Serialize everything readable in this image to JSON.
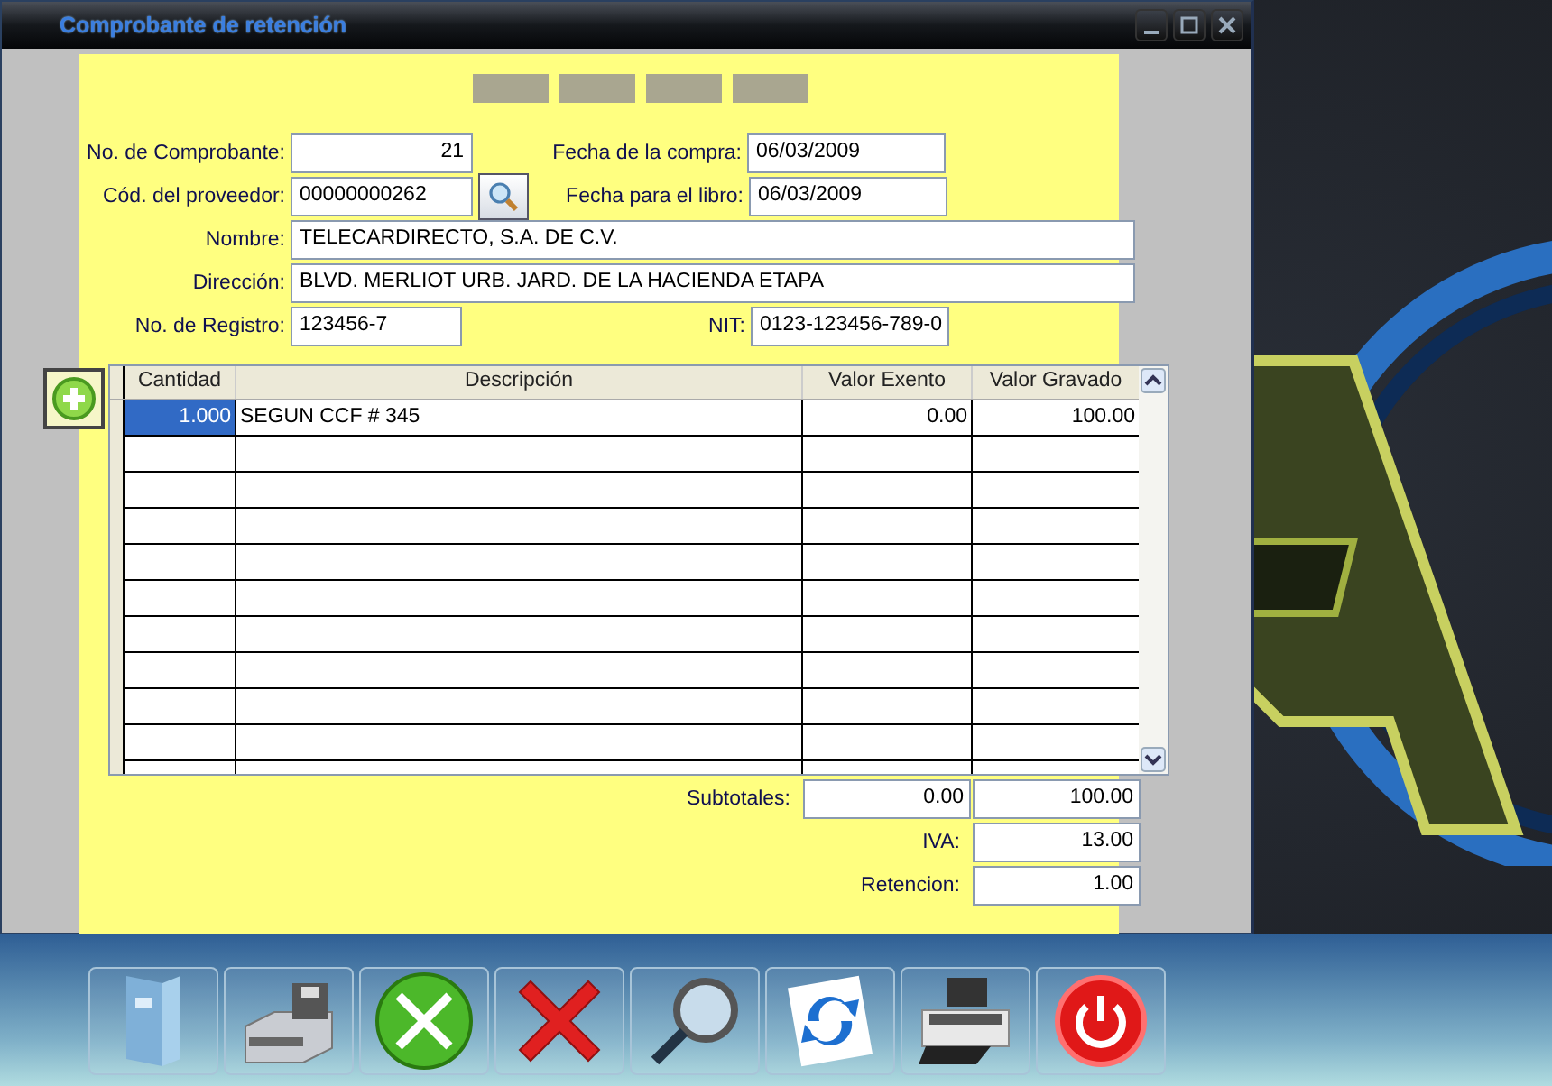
{
  "window": {
    "title": "Comprobante de retención"
  },
  "form": {
    "comprobante": {
      "label": "No. de Comprobante:",
      "value": "21"
    },
    "fecha_compra": {
      "label": "Fecha de la compra:",
      "value": "06/03/2009"
    },
    "proveedor": {
      "label": "Cód. del proveedor:",
      "value": "00000000262"
    },
    "fecha_libro": {
      "label": "Fecha para el libro:",
      "value": "06/03/2009"
    },
    "nombre": {
      "label": "Nombre:",
      "value": "TELECARDIRECTO, S.A. DE C.V."
    },
    "direccion": {
      "label": "Dirección:",
      "value": "BLVD. MERLIOT URB. JARD. DE LA HACIENDA ETAPA"
    },
    "registro": {
      "label": "No. de Registro:",
      "value": "123456-7"
    },
    "nit": {
      "label": "NIT:",
      "value": "0123-123456-789-0"
    }
  },
  "table": {
    "columns": [
      "Cantidad",
      "Descripción",
      "Valor Exento",
      "Valor Gravado"
    ],
    "rows": [
      {
        "cantidad": "1.000",
        "descripcion": "SEGUN CCF # 345",
        "valor_exento": "0.00",
        "valor_gravado": "100.00",
        "selected": true
      }
    ]
  },
  "totals": {
    "subtotales": {
      "label": "Subtotales:",
      "exento": "0.00",
      "gravado": "100.00"
    },
    "iva": {
      "label": "IVA:",
      "value": "13.00"
    },
    "retencion": {
      "label": "Retencion:",
      "value": "1.00"
    }
  }
}
